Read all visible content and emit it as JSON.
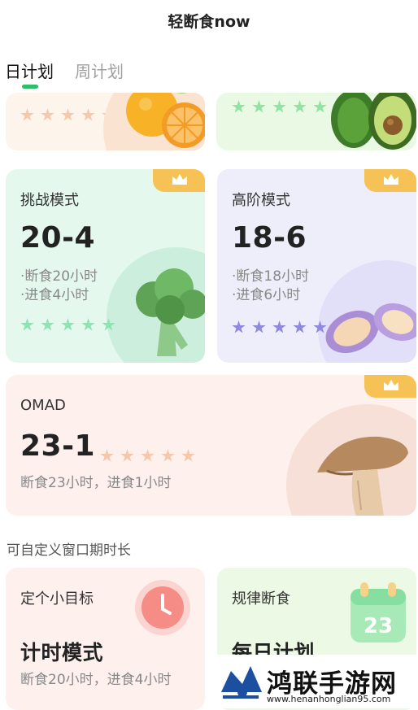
{
  "header": {
    "title": "轻断食now"
  },
  "tabs": [
    {
      "label": "日计划",
      "active": true
    },
    {
      "label": "周计划",
      "active": false
    }
  ],
  "cards": {
    "top_left": {
      "stars": 5,
      "star_color": "#f6c9ad"
    },
    "top_right": {
      "stars": 5,
      "star_color": "#90e3a4"
    },
    "challenge": {
      "label": "挑战模式",
      "ratio": "20-4",
      "line1": "·断食20小时",
      "line2": "·进食4小时",
      "stars": 5,
      "star_color": "#8ee3b2",
      "icon": "broccoli-icon"
    },
    "advanced": {
      "label": "高阶模式",
      "ratio": "18-6",
      "line1": "·断食18小时",
      "line2": "·进食6小时",
      "stars": 5,
      "star_color": "#8f89e0",
      "icon": "sweet-potato-icon"
    },
    "omad": {
      "label": "OMAD",
      "ratio": "23-1",
      "desc": "断食23小时，进食1小时",
      "stars": 5,
      "star_color": "#f7c7ad",
      "icon": "mushroom-icon"
    }
  },
  "section": {
    "label": "可自定义窗口期时长"
  },
  "bottom_cards": {
    "target": {
      "label": "定个小目标",
      "title": "计时模式",
      "desc": "断食20小时，进食4小时",
      "icon": "clock-icon"
    },
    "regular": {
      "label": "规律断食",
      "title": "每日计划",
      "calendar_day": "23",
      "icon": "calendar-icon"
    }
  },
  "watermark": {
    "text": "鸿联手游网",
    "url": "www.henanhonglian95.com"
  },
  "colors": {
    "accent": "#2bbf6a",
    "crown": "#f6c256"
  }
}
